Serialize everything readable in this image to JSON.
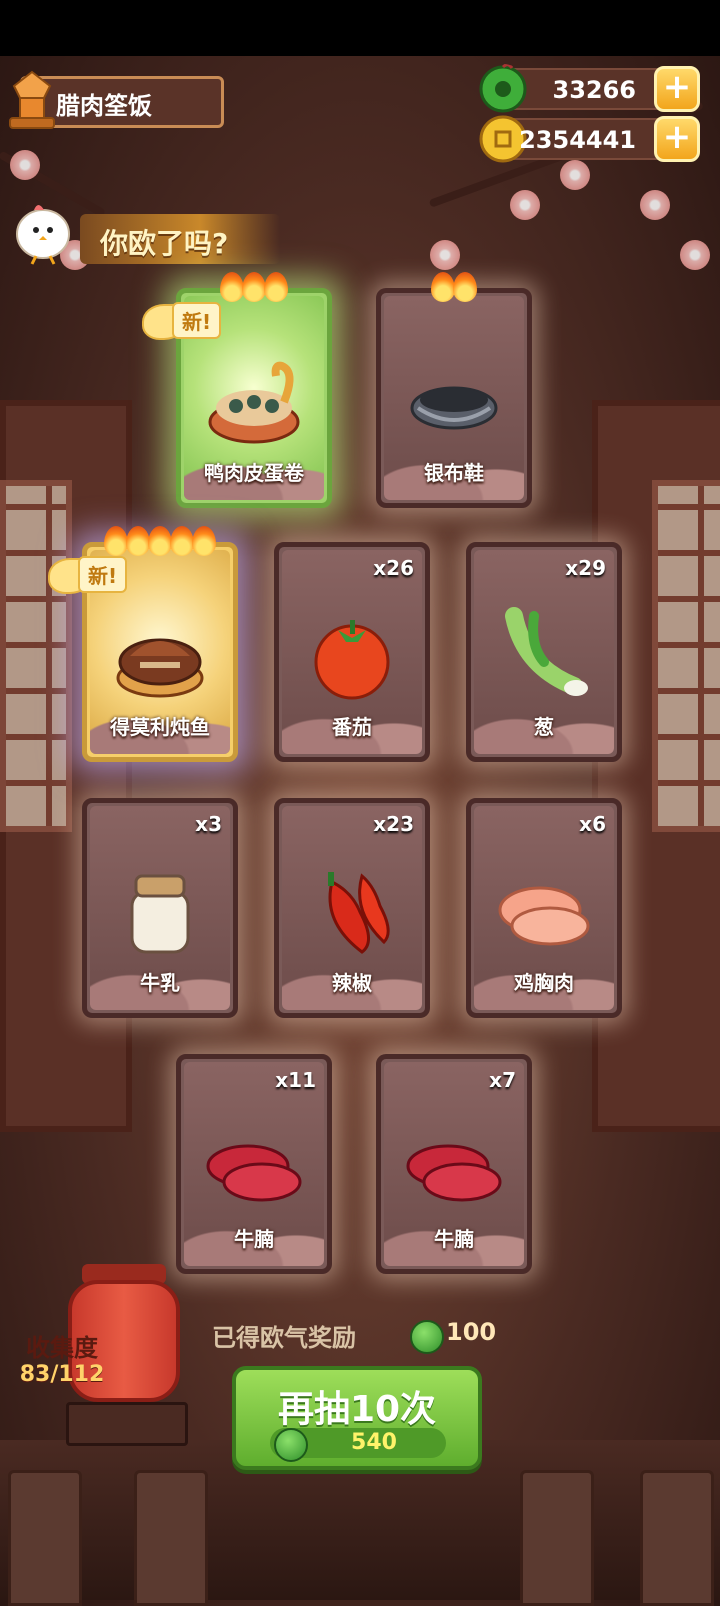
{
  "header": {
    "recipe_title": "腊肉筌饭",
    "banner_text": "你欧了吗?"
  },
  "currency": {
    "jade": "33266",
    "coins": "2354441",
    "jade_icon": "jade-coin-icon",
    "coin_icon": "gold-coin-icon",
    "plus_label": "+"
  },
  "cards": [
    {
      "name": "鸭肉皮蛋卷",
      "qty": "",
      "rarity_flames": 3,
      "new": true,
      "style": "green",
      "icon": "duck-egg-roll-icon"
    },
    {
      "name": "银布鞋",
      "qty": "",
      "rarity_flames": 2,
      "new": false,
      "style": "normal",
      "icon": "silver-shoe-icon"
    },
    {
      "name": "得莫利炖鱼",
      "qty": "",
      "rarity_flames": 5,
      "new": true,
      "style": "gold",
      "icon": "stewed-fish-icon"
    },
    {
      "name": "番茄",
      "qty": "x26",
      "rarity_flames": 0,
      "new": false,
      "style": "normal",
      "icon": "tomato-icon"
    },
    {
      "name": "葱",
      "qty": "x29",
      "rarity_flames": 0,
      "new": false,
      "style": "normal",
      "icon": "scallion-icon"
    },
    {
      "name": "牛乳",
      "qty": "x3",
      "rarity_flames": 0,
      "new": false,
      "style": "normal",
      "icon": "milk-jar-icon"
    },
    {
      "name": "辣椒",
      "qty": "x23",
      "rarity_flames": 0,
      "new": false,
      "style": "normal",
      "icon": "chili-icon"
    },
    {
      "name": "鸡胸肉",
      "qty": "x6",
      "rarity_flames": 0,
      "new": false,
      "style": "normal",
      "icon": "chicken-breast-icon"
    },
    {
      "name": "牛腩",
      "qty": "x11",
      "rarity_flames": 0,
      "new": false,
      "style": "normal",
      "icon": "beef-icon"
    },
    {
      "name": "牛腩",
      "qty": "x7",
      "rarity_flames": 0,
      "new": false,
      "style": "normal",
      "icon": "beef-icon"
    }
  ],
  "new_label": "新!",
  "collection": {
    "label": "收集度",
    "progress": "83/112"
  },
  "reward": {
    "label": "已得欧气奖励",
    "value": "100"
  },
  "draw_button": {
    "label": "再抽10次",
    "cost": "540"
  }
}
